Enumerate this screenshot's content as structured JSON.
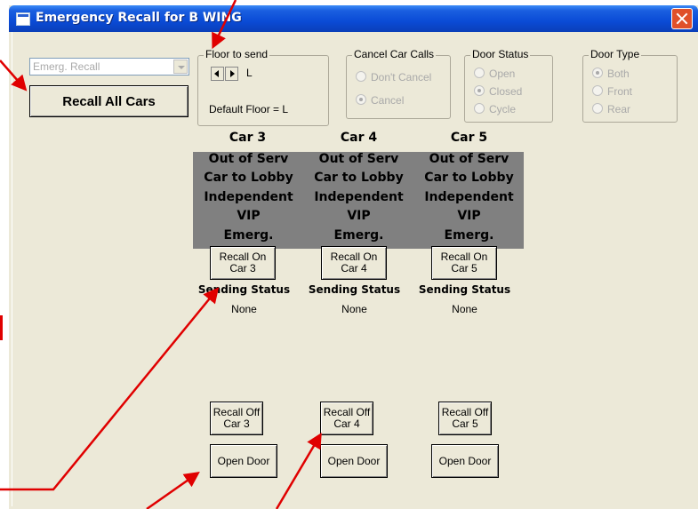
{
  "window": {
    "title": "Emergency Recall for B WING"
  },
  "mode_select": {
    "value": "Emerg. Recall"
  },
  "recall_all_label": "Recall All Cars",
  "floor_group": {
    "label": "Floor to send",
    "floor": "L",
    "default_text": "Default Floor = L"
  },
  "cancel_group": {
    "label": "Cancel Car Calls",
    "options": [
      "Don't Cancel",
      "Cancel"
    ],
    "selected": 1
  },
  "door_status_group": {
    "label": "Door Status",
    "options": [
      "Open",
      "Closed",
      "Cycle"
    ],
    "selected": 1
  },
  "door_type_group": {
    "label": "Door Type",
    "options": [
      "Both",
      "Front",
      "Rear"
    ],
    "selected": 0
  },
  "cars": [
    {
      "name": "Car 3",
      "status": [
        "Out of Serv",
        "Car to Lobby",
        "Independent",
        "VIP",
        "Emerg."
      ],
      "recall_on": [
        "Recall On",
        "Car 3"
      ],
      "sending_label": "Sending Status",
      "sending_value": "None",
      "recall_off": [
        "Recall Off",
        "Car 3"
      ],
      "open_door": "Open Door"
    },
    {
      "name": "Car 4",
      "status": [
        "Out of Serv",
        "Car to Lobby",
        "Independent",
        "VIP",
        "Emerg."
      ],
      "recall_on": [
        "Recall On",
        "Car 4"
      ],
      "sending_label": "Sending Status",
      "sending_value": "None",
      "recall_off": [
        "Recall Off",
        "Car 4"
      ],
      "open_door": "Open Door"
    },
    {
      "name": "Car 5",
      "status": [
        "Out of Serv",
        "Car to Lobby",
        "Independent",
        "VIP",
        "Emerg."
      ],
      "recall_on": [
        "Recall On",
        "Car 5"
      ],
      "sending_label": "Sending Status",
      "sending_value": "None",
      "recall_off": [
        "Recall Off",
        "Car 5"
      ],
      "open_door": "Open Door"
    }
  ],
  "annotation_color": "#e00000"
}
